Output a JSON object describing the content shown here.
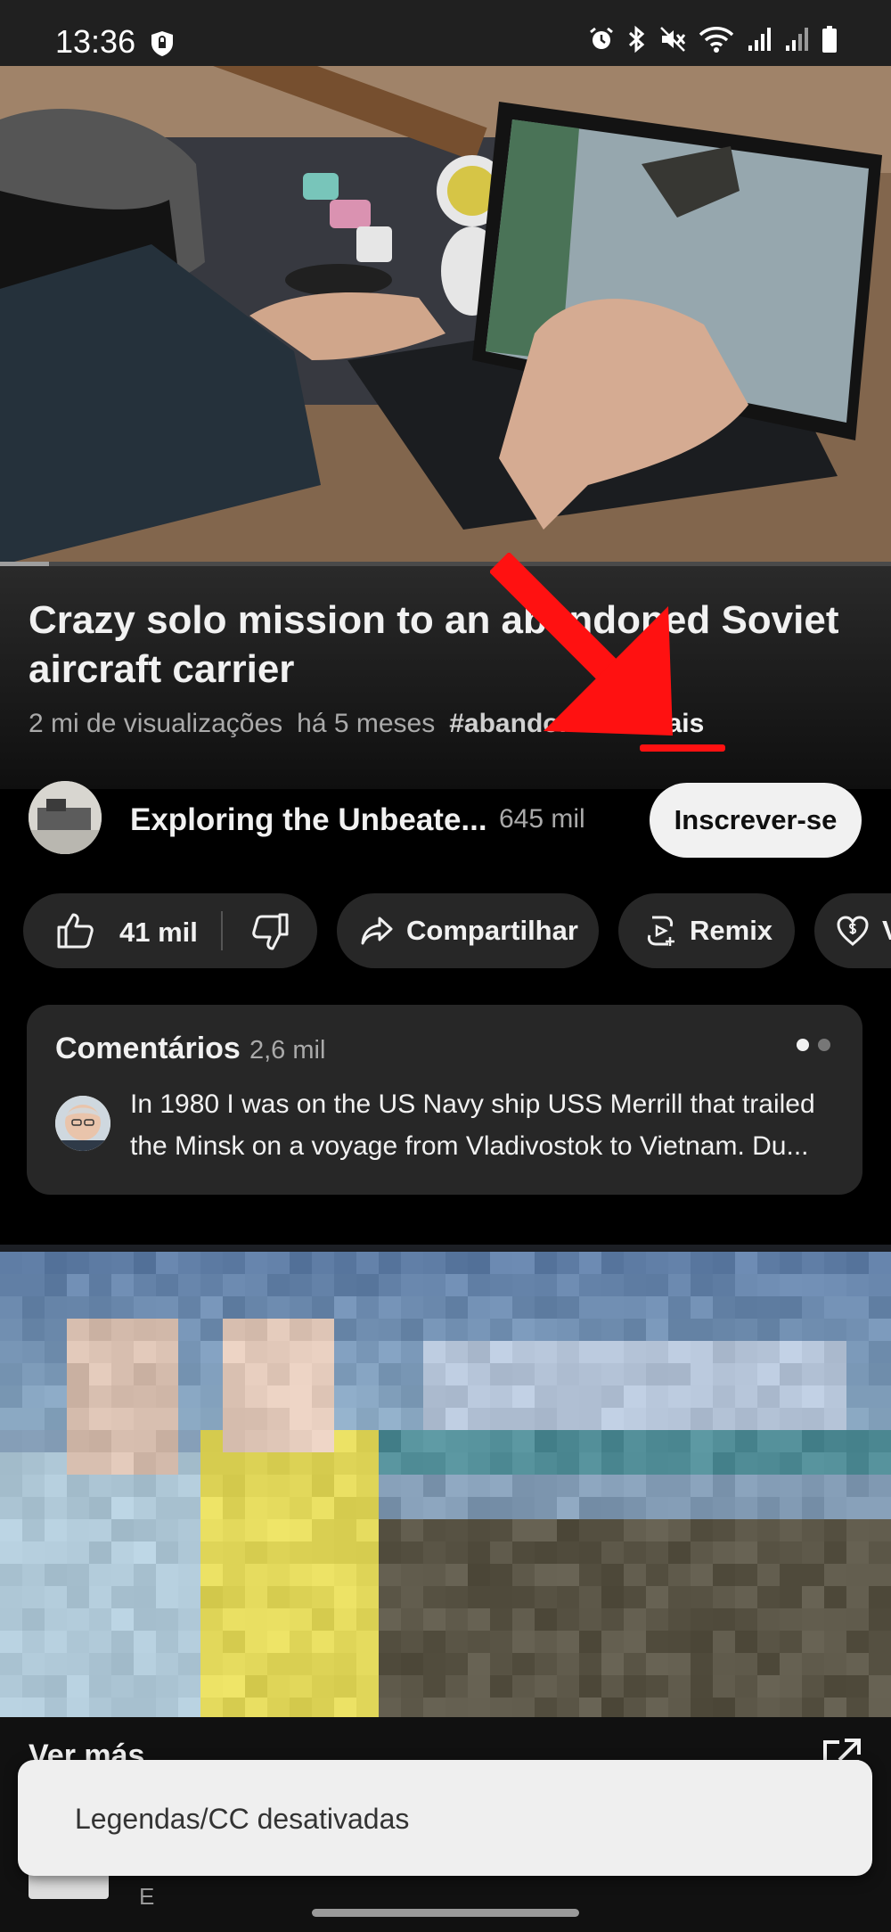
{
  "status_bar": {
    "time": "13:36",
    "icons": [
      "shield-icon",
      "alarm-icon",
      "bluetooth-icon",
      "mute-icon",
      "wifi-icon",
      "signal-icon",
      "signal-icon",
      "battery-icon"
    ]
  },
  "video": {
    "title": "Crazy solo mission to an abandoned Soviet aircraft carrier",
    "progress": 0.055
  },
  "meta": {
    "views": "2 mi de visualizações",
    "age": "há 5 meses",
    "hashtag": "#abandoned",
    "more": "...mais"
  },
  "channel": {
    "name": "Exploring the Unbeate...",
    "subscribers": "645 mil",
    "subscribe_label": "Inscrever-se"
  },
  "actions": {
    "likes": "41 mil",
    "share_label": "Compartilhar",
    "remix_label": "Remix",
    "thanks_label": "V"
  },
  "comments": {
    "title": "Comentários",
    "count": "2,6 mil",
    "top_comment_line1": "In 1980 I was on the US Navy ship USS Merrill that trailed",
    "top_comment_line2": "the Minsk on a voyage from Vladivostok to Vietnam. Du..."
  },
  "ad": {
    "see_more": "Ver más",
    "description": "E"
  },
  "toast": {
    "text": "Legendas/CC desativadas"
  },
  "colors": {
    "annotation_red": "#ff1111",
    "background": "#000000",
    "pill": "#272727"
  }
}
